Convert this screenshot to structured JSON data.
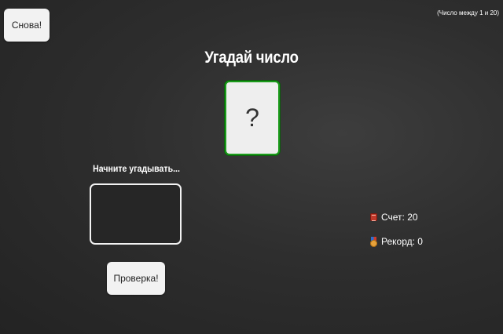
{
  "header": {
    "again_label": "Снова!",
    "range_hint": "(Число между 1 и 20)"
  },
  "main": {
    "title": "Угадай число",
    "secret_number": "?",
    "message": "Начните угадывать...",
    "guess_value": "",
    "check_label": "Проверка!"
  },
  "stats": {
    "score_label": "Счет: 20",
    "score_icon": "score-icon",
    "record_label": "Рекорд: 0",
    "record_icon": "medal-icon"
  },
  "colors": {
    "accent_border": "#1a9a1a",
    "background": "#2e2e2e",
    "button_bg": "#f2f2f2"
  }
}
